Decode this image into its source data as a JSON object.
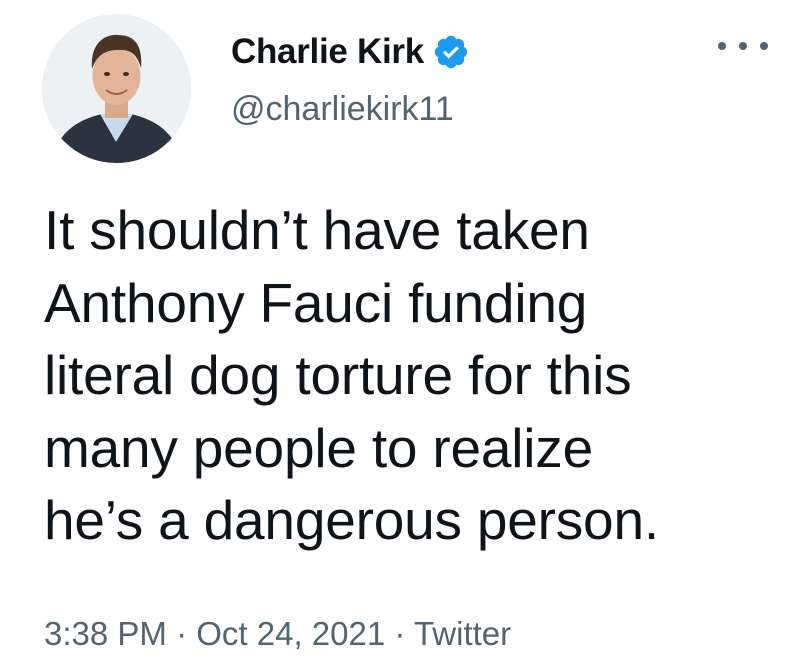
{
  "author": {
    "display_name": "Charlie Kirk",
    "handle": "@charliekirk11",
    "verified": true,
    "verified_color": "#1d9bf0"
  },
  "more_menu": {
    "icon": "more-horizontal-icon"
  },
  "tweet": {
    "text_lines": [
      "It shouldn’t have taken",
      "Anthony Fauci funding",
      "literal dog torture for this",
      "many people to realize",
      "he’s a dangerous person."
    ]
  },
  "meta": {
    "time": "3:38 PM",
    "separator": " · ",
    "date": "Oct 24, 2021",
    "source": "Twitter"
  }
}
